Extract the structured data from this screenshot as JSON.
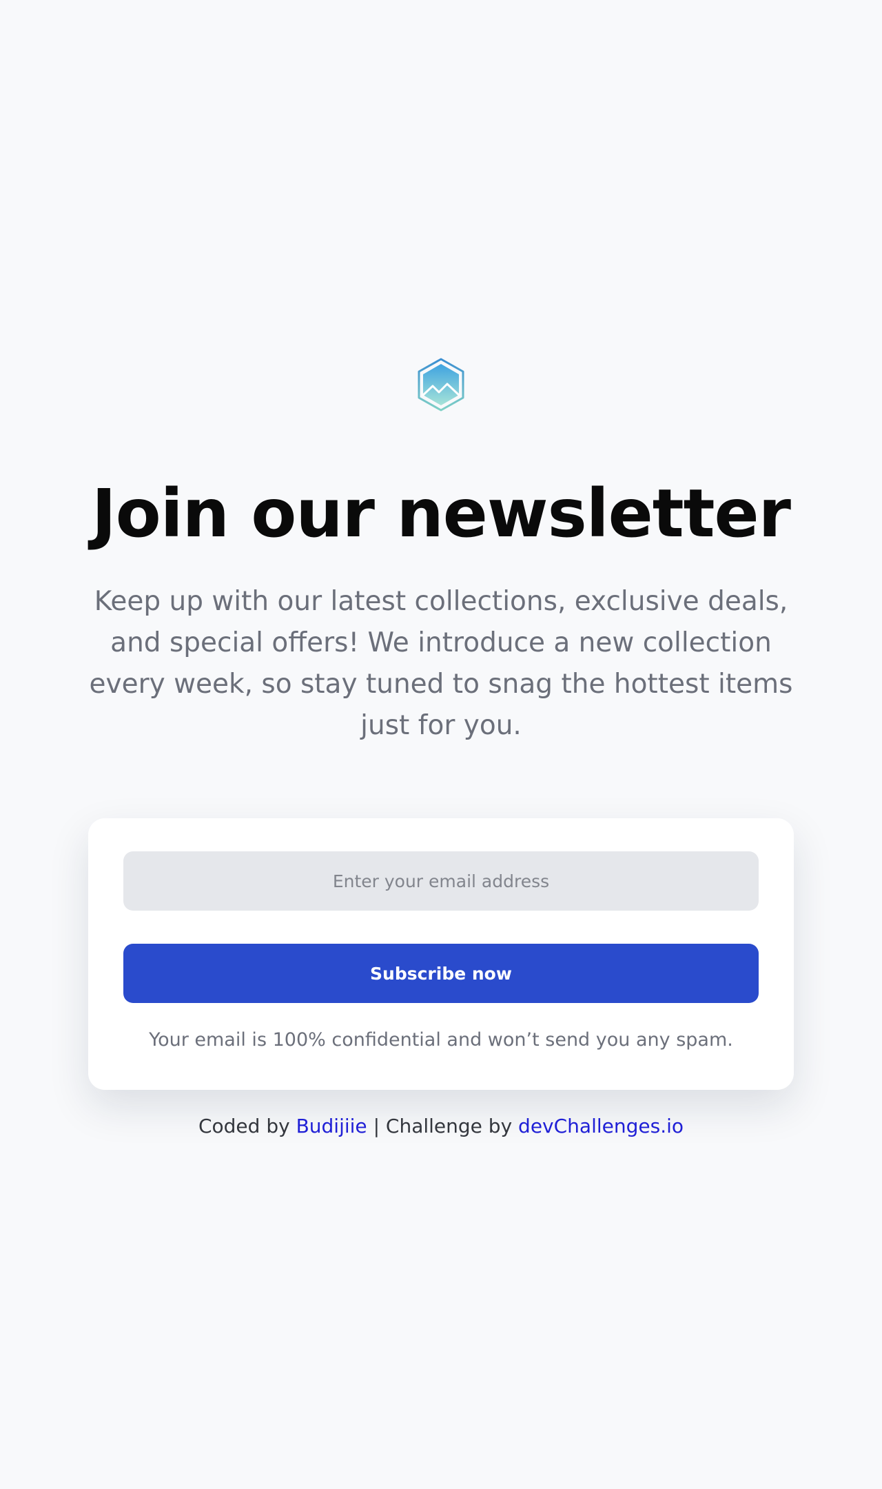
{
  "logo": {
    "icon": "mountain-hexagon-logo-icon"
  },
  "hero": {
    "title": "Join our newsletter",
    "subtitle": "Keep up with our latest collections, exclusive deals, and special offers! We introduce a new collection every week, so stay tuned to snag the hottest items just for you."
  },
  "form": {
    "email_placeholder": "Enter your email address",
    "email_value": "",
    "subscribe_label": "Subscribe now",
    "disclaimer": "Your email is 100% confidential and won’t send you any spam."
  },
  "footer": {
    "coded_by_text": "Coded by",
    "author_link": "Budijiie",
    "separator": "|",
    "challenge_text": "Challenge by",
    "challenge_link": "devChallenges.io"
  },
  "colors": {
    "background": "#f8f9fb",
    "title": "#0a0a0a",
    "body_text": "#6b6f7a",
    "input_background": "#e5e7eb",
    "button": "#2a4bcc",
    "link": "#1f1fd6"
  }
}
